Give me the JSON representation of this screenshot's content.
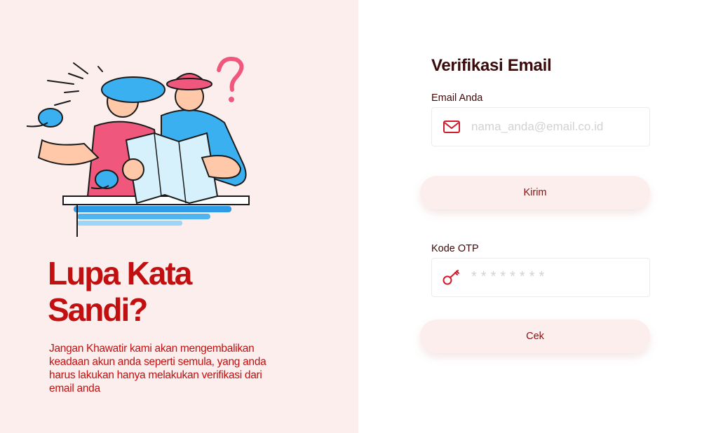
{
  "left": {
    "headline": "Lupa Kata Sandi?",
    "description": "Jangan Khawatir kami akan mengembalikan keadaan akun anda seperti semula, yang anda harus lakukan hanya melakukan verifikasi dari email anda"
  },
  "form": {
    "title": "Verifikasi Email",
    "email": {
      "label": "Email Anda",
      "placeholder": "nama_anda@email.co.id",
      "value": "",
      "icon": "mail-icon"
    },
    "send_button_label": "Kirim",
    "otp": {
      "label": "Kode OTP",
      "placeholder": "********",
      "value": "",
      "icon": "key-icon"
    },
    "check_button_label": "Cek"
  },
  "colors": {
    "accent": "#c20f0f",
    "panel_bg": "#fdeeee",
    "title_text": "#3b0a0a"
  }
}
